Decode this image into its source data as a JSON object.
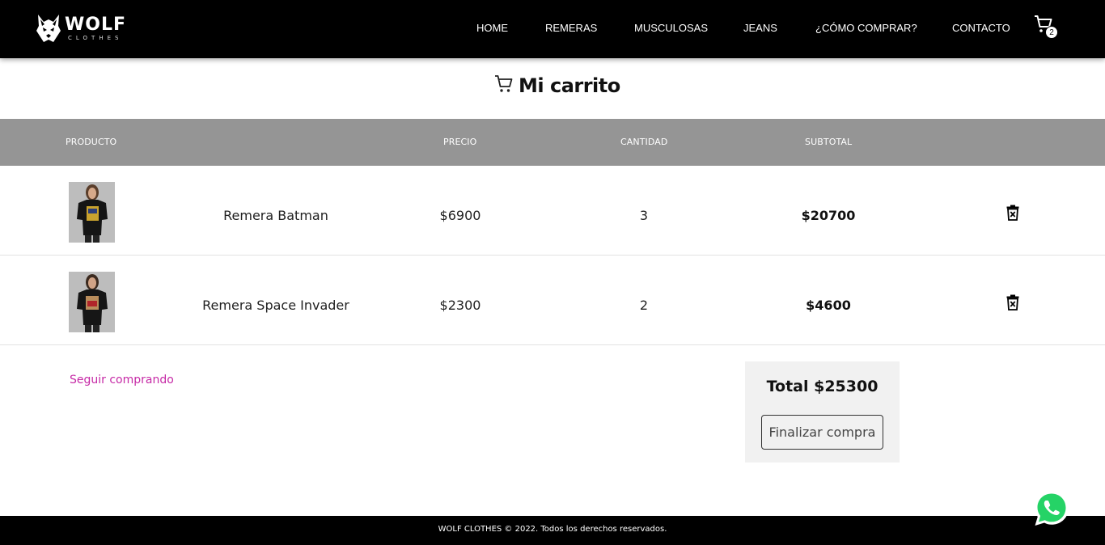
{
  "brand": {
    "name": "WOLF",
    "tagline": "CLOTHES"
  },
  "nav": {
    "links": [
      "HOME",
      "REMERAS",
      "MUSCULOSAS",
      "JEANS",
      "¿CÓMO COMPRAR?",
      "CONTACTO"
    ],
    "cart_count": "2",
    "cart_icon": "shopping-cart-icon"
  },
  "page": {
    "title": "Mi carrito",
    "title_icon": "shopping-cart-icon"
  },
  "table": {
    "headers": [
      "PRODUCTO",
      "PRECIO",
      "CANTIDAD",
      "SUBTOTAL"
    ],
    "rows": [
      {
        "name": "Remera Batman",
        "price": "$6900",
        "qty": "3",
        "subtotal": "$20700"
      },
      {
        "name": "Remera Space Invader",
        "price": "$2300",
        "qty": "2",
        "subtotal": "$4600"
      }
    ],
    "delete_icon": "trash-icon"
  },
  "summary": {
    "continue_label": "Seguir comprando",
    "total_label": "Total $25300",
    "checkout_label": "Finalizar compra"
  },
  "footer": {
    "text": "WOLF CLOTHES © 2022. Todos los derechos reservados."
  },
  "colors": {
    "navbar_bg": "#000000",
    "table_header_bg": "#959595",
    "link_accent": "#c62aa6",
    "total_box_bg": "#f1f1f1",
    "whatsapp_green": "#25d366"
  },
  "floating": {
    "whatsapp_icon": "whatsapp-icon"
  }
}
